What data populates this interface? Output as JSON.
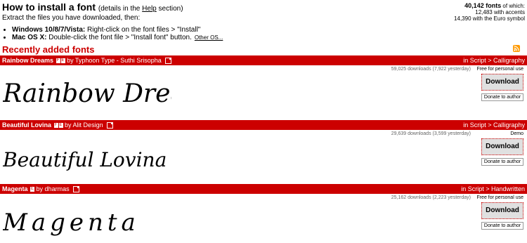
{
  "howto": {
    "title": "How to install a font",
    "details_prefix": "(details in the ",
    "details_link": "Help",
    "details_suffix": " section)",
    "extract": "Extract the files you have downloaded, then:",
    "items": [
      {
        "os": "Windows 10/8/7/Vista:",
        "text": " Right-click on the font files > \"Install\""
      },
      {
        "os": "Mac OS X:",
        "text": " Double-click the font file > \"Install font\" button."
      }
    ],
    "other_os": "Other OS..."
  },
  "stats": {
    "total": "40,142 fonts",
    "total_suffix": " of which:",
    "accents": "12,483 with accents",
    "euro": "14,390 with the Euro symbol"
  },
  "recent": {
    "title": "Recently added fonts",
    "rss_icon": "rss-icon"
  },
  "fonts": [
    {
      "name": "Rainbow Dreams",
      "badges": [
        "F",
        "E"
      ],
      "author": "by Typhoon Type - Suthi Srisopha",
      "category": "in Script > Calligraphy",
      "downloads": "59,025 downloads (7,922 yesterday)",
      "license": "Free for personal use",
      "download_label": "Download",
      "donate_label": "Donate to author",
      "preview_text": "Rainbow Dreams"
    },
    {
      "name": "Beautiful Lovina",
      "badges": [
        "F",
        "E"
      ],
      "author": "by Alit Design",
      "category": "in Script > Calligraphy",
      "downloads": "29,639 downloads (3,599 yesterday)",
      "license": "Demo",
      "download_label": "Download",
      "donate_label": "Donate to author",
      "preview_text": "Beautiful Lovina"
    },
    {
      "name": "Magenta",
      "badges": [
        "E"
      ],
      "author": "by dharmas",
      "category": "in Script > Handwritten",
      "downloads": "25,162 downloads (2,223 yesterday)",
      "license": "Free for personal use",
      "download_label": "Download",
      "donate_label": "Donate to author",
      "preview_text": "Magenta"
    }
  ],
  "colors": {
    "accent": "#cc0000"
  }
}
